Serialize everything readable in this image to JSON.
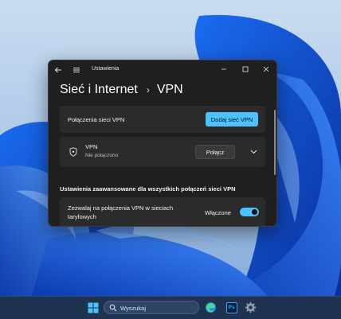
{
  "window": {
    "title": "Ustawienia",
    "breadcrumb_parent": "Sieć i Internet",
    "breadcrumb_separator": "›",
    "breadcrumb_current": "VPN"
  },
  "vpn_connections": {
    "label": "Połączenia sieci VPN",
    "add_button": "Dodaj sieć VPN"
  },
  "vpn_entry": {
    "name": "VPN",
    "status": "Nie połączono",
    "connect_button": "Połącz"
  },
  "advanced": {
    "title": "Ustawienia zaawansowane dla wszystkich połączeń sieci VPN",
    "metered_label_line1": "Zezwalaj na połączenia VPN w sieciach",
    "metered_label_line2": "taryfowych",
    "metered_state": "Włączone",
    "metered_on": true
  },
  "taskbar": {
    "search_placeholder": "Wyszukaj",
    "ps_label": "Ps"
  },
  "colors": {
    "accent": "#4cc2ff",
    "window_bg": "#1f1f1f",
    "card_bg": "#2b2b2b",
    "taskbar_bg": "#1e3350"
  },
  "icons": {
    "back": "back-arrow-icon",
    "menu": "hamburger-menu-icon",
    "minimize": "minimize-icon",
    "maximize": "maximize-icon",
    "close": "close-icon",
    "vpn_shield": "shield-icon",
    "expand": "chevron-down-icon",
    "start": "windows-start-icon",
    "search": "search-icon",
    "edge": "edge-icon",
    "photoshop": "photoshop-icon",
    "settings": "gear-icon"
  }
}
